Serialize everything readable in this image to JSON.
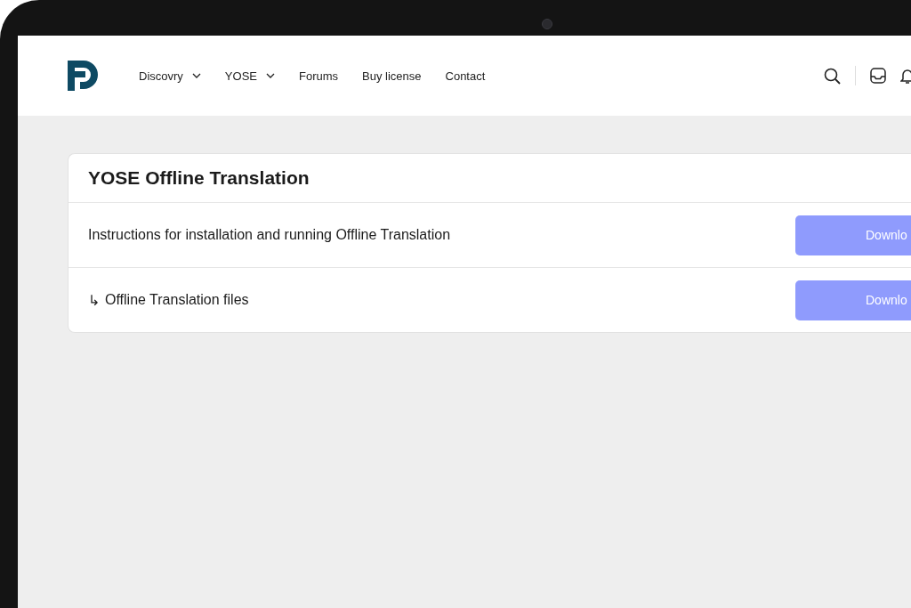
{
  "nav": {
    "items": [
      {
        "label": "Discovry",
        "dropdown": true
      },
      {
        "label": "YOSE",
        "dropdown": true
      },
      {
        "label": "Forums",
        "dropdown": false
      },
      {
        "label": "Buy license",
        "dropdown": false
      },
      {
        "label": "Contact",
        "dropdown": false
      }
    ]
  },
  "card": {
    "title": "YOSE Offline Translation",
    "rows": [
      {
        "arrow": "",
        "text": "Instructions for installation and running Offline Translation",
        "button": "Downlo"
      },
      {
        "arrow": "↳",
        "text": "Offline Translation files",
        "button": "Downlo"
      }
    ]
  }
}
